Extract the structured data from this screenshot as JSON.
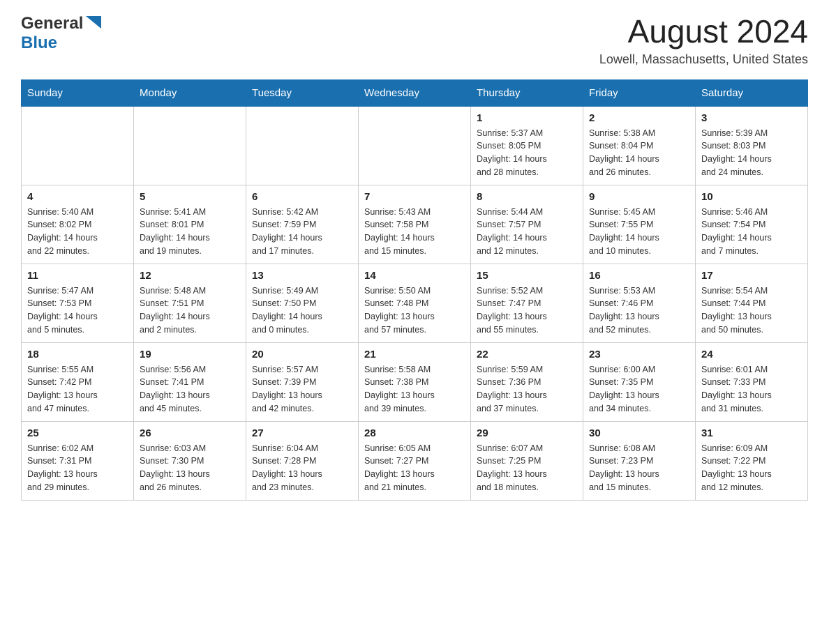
{
  "header": {
    "logo_general": "General",
    "logo_blue": "Blue",
    "title": "August 2024",
    "subtitle": "Lowell, Massachusetts, United States"
  },
  "days_of_week": [
    "Sunday",
    "Monday",
    "Tuesday",
    "Wednesday",
    "Thursday",
    "Friday",
    "Saturday"
  ],
  "weeks": [
    [
      {
        "day": "",
        "info": ""
      },
      {
        "day": "",
        "info": ""
      },
      {
        "day": "",
        "info": ""
      },
      {
        "day": "",
        "info": ""
      },
      {
        "day": "1",
        "info": "Sunrise: 5:37 AM\nSunset: 8:05 PM\nDaylight: 14 hours\nand 28 minutes."
      },
      {
        "day": "2",
        "info": "Sunrise: 5:38 AM\nSunset: 8:04 PM\nDaylight: 14 hours\nand 26 minutes."
      },
      {
        "day": "3",
        "info": "Sunrise: 5:39 AM\nSunset: 8:03 PM\nDaylight: 14 hours\nand 24 minutes."
      }
    ],
    [
      {
        "day": "4",
        "info": "Sunrise: 5:40 AM\nSunset: 8:02 PM\nDaylight: 14 hours\nand 22 minutes."
      },
      {
        "day": "5",
        "info": "Sunrise: 5:41 AM\nSunset: 8:01 PM\nDaylight: 14 hours\nand 19 minutes."
      },
      {
        "day": "6",
        "info": "Sunrise: 5:42 AM\nSunset: 7:59 PM\nDaylight: 14 hours\nand 17 minutes."
      },
      {
        "day": "7",
        "info": "Sunrise: 5:43 AM\nSunset: 7:58 PM\nDaylight: 14 hours\nand 15 minutes."
      },
      {
        "day": "8",
        "info": "Sunrise: 5:44 AM\nSunset: 7:57 PM\nDaylight: 14 hours\nand 12 minutes."
      },
      {
        "day": "9",
        "info": "Sunrise: 5:45 AM\nSunset: 7:55 PM\nDaylight: 14 hours\nand 10 minutes."
      },
      {
        "day": "10",
        "info": "Sunrise: 5:46 AM\nSunset: 7:54 PM\nDaylight: 14 hours\nand 7 minutes."
      }
    ],
    [
      {
        "day": "11",
        "info": "Sunrise: 5:47 AM\nSunset: 7:53 PM\nDaylight: 14 hours\nand 5 minutes."
      },
      {
        "day": "12",
        "info": "Sunrise: 5:48 AM\nSunset: 7:51 PM\nDaylight: 14 hours\nand 2 minutes."
      },
      {
        "day": "13",
        "info": "Sunrise: 5:49 AM\nSunset: 7:50 PM\nDaylight: 14 hours\nand 0 minutes."
      },
      {
        "day": "14",
        "info": "Sunrise: 5:50 AM\nSunset: 7:48 PM\nDaylight: 13 hours\nand 57 minutes."
      },
      {
        "day": "15",
        "info": "Sunrise: 5:52 AM\nSunset: 7:47 PM\nDaylight: 13 hours\nand 55 minutes."
      },
      {
        "day": "16",
        "info": "Sunrise: 5:53 AM\nSunset: 7:46 PM\nDaylight: 13 hours\nand 52 minutes."
      },
      {
        "day": "17",
        "info": "Sunrise: 5:54 AM\nSunset: 7:44 PM\nDaylight: 13 hours\nand 50 minutes."
      }
    ],
    [
      {
        "day": "18",
        "info": "Sunrise: 5:55 AM\nSunset: 7:42 PM\nDaylight: 13 hours\nand 47 minutes."
      },
      {
        "day": "19",
        "info": "Sunrise: 5:56 AM\nSunset: 7:41 PM\nDaylight: 13 hours\nand 45 minutes."
      },
      {
        "day": "20",
        "info": "Sunrise: 5:57 AM\nSunset: 7:39 PM\nDaylight: 13 hours\nand 42 minutes."
      },
      {
        "day": "21",
        "info": "Sunrise: 5:58 AM\nSunset: 7:38 PM\nDaylight: 13 hours\nand 39 minutes."
      },
      {
        "day": "22",
        "info": "Sunrise: 5:59 AM\nSunset: 7:36 PM\nDaylight: 13 hours\nand 37 minutes."
      },
      {
        "day": "23",
        "info": "Sunrise: 6:00 AM\nSunset: 7:35 PM\nDaylight: 13 hours\nand 34 minutes."
      },
      {
        "day": "24",
        "info": "Sunrise: 6:01 AM\nSunset: 7:33 PM\nDaylight: 13 hours\nand 31 minutes."
      }
    ],
    [
      {
        "day": "25",
        "info": "Sunrise: 6:02 AM\nSunset: 7:31 PM\nDaylight: 13 hours\nand 29 minutes."
      },
      {
        "day": "26",
        "info": "Sunrise: 6:03 AM\nSunset: 7:30 PM\nDaylight: 13 hours\nand 26 minutes."
      },
      {
        "day": "27",
        "info": "Sunrise: 6:04 AM\nSunset: 7:28 PM\nDaylight: 13 hours\nand 23 minutes."
      },
      {
        "day": "28",
        "info": "Sunrise: 6:05 AM\nSunset: 7:27 PM\nDaylight: 13 hours\nand 21 minutes."
      },
      {
        "day": "29",
        "info": "Sunrise: 6:07 AM\nSunset: 7:25 PM\nDaylight: 13 hours\nand 18 minutes."
      },
      {
        "day": "30",
        "info": "Sunrise: 6:08 AM\nSunset: 7:23 PM\nDaylight: 13 hours\nand 15 minutes."
      },
      {
        "day": "31",
        "info": "Sunrise: 6:09 AM\nSunset: 7:22 PM\nDaylight: 13 hours\nand 12 minutes."
      }
    ]
  ]
}
